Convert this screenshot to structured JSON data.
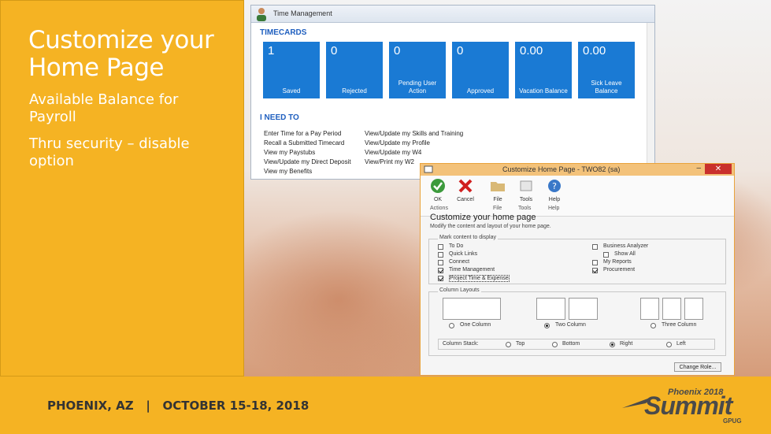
{
  "slide": {
    "title": "Customize your Home Page",
    "bullets": [
      "Available Balance for Payroll",
      "Thru security – disable option"
    ],
    "footer": "PHOENIX, AZ   |   OCTOBER 15-18, 2018",
    "logo": {
      "line1": "Phoenix 2018",
      "line2": "Summit",
      "line3": "GPUG"
    },
    "colors": {
      "accent": "#f5b323",
      "tile": "#1a7ad4",
      "header_blue": "#1f5fbf"
    }
  },
  "time_management": {
    "window_title": "Time Management",
    "timecards_heading": "TIMECARDS",
    "tiles": [
      {
        "value": "1",
        "label": "Saved"
      },
      {
        "value": "0",
        "label": "Rejected"
      },
      {
        "value": "0",
        "label": "Pending User Action"
      },
      {
        "value": "0",
        "label": "Approved"
      },
      {
        "value": "0.00",
        "label": "Vacation Balance"
      },
      {
        "value": "0.00",
        "label": "Sick Leave Balance"
      }
    ],
    "ineed_heading": "I NEED TO",
    "links_col1": [
      "Enter Time for a Pay Period",
      "Recall a Submitted Timecard",
      "View my Paystubs",
      "View/Update my Direct Deposit",
      "View my Benefits"
    ],
    "links_col2": [
      "View/Update my Skills and Training",
      "View/Update my Profile",
      "View/Update my W4",
      "View/Print my W2"
    ]
  },
  "customize_dialog": {
    "window_title": "Customize Home Page - TWO82 (sa)",
    "ribbon": {
      "ok": "OK",
      "cancel": "Cancel",
      "file": "File",
      "tools": "Tools",
      "help": "Help",
      "groups": [
        "Actions",
        "File",
        "Tools",
        "Help"
      ]
    },
    "heading": "Customize your home page",
    "subheading": "Modify the content and layout of your home page.",
    "content_frame": "Mark content to display",
    "left_items": [
      {
        "label": "To Do",
        "checked": false
      },
      {
        "label": "Quick Links",
        "checked": false
      },
      {
        "label": "Connect",
        "checked": false
      },
      {
        "label": "Time Management",
        "checked": true
      },
      {
        "label": "Project Time & Expense",
        "checked": true
      }
    ],
    "right_items": [
      {
        "label": "Business Analyzer",
        "checked": false
      },
      {
        "label": "Show All",
        "checked": false
      },
      {
        "label": "My Reports",
        "checked": false
      },
      {
        "label": "Procurement",
        "checked": true
      }
    ],
    "layouts_frame": "Column Layouts",
    "layouts": [
      {
        "label": "One Column",
        "selected": false
      },
      {
        "label": "Two Column",
        "selected": true
      },
      {
        "label": "Three Column",
        "selected": false
      }
    ],
    "column_stack_label": "Column Stack:",
    "stack_options": [
      {
        "label": "Top",
        "selected": false
      },
      {
        "label": "Bottom",
        "selected": false
      },
      {
        "label": "Right",
        "selected": true
      },
      {
        "label": "Left",
        "selected": false
      }
    ],
    "change_role": "Change Role..."
  }
}
